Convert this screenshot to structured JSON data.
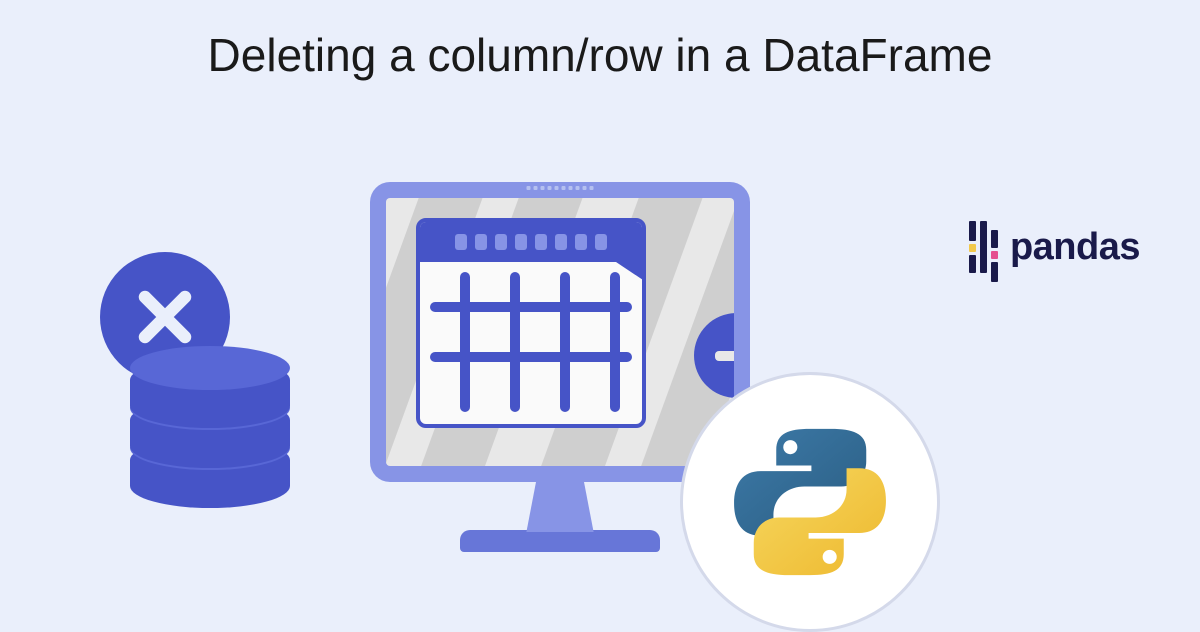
{
  "title": "Deleting a column/row in a DataFrame",
  "pandas_label": "pandas",
  "icons": {
    "x_badge": "close-icon",
    "minus_badge": "minus-icon",
    "database": "database-icon",
    "monitor": "monitor-icon",
    "grid": "grid-icon",
    "python": "python-logo-icon",
    "pandas": "pandas-logo-icon"
  },
  "colors": {
    "background": "#eaeffb",
    "primary_blue": "#4654c7",
    "light_blue": "#8794e6",
    "python_blue": "#3d7aa8",
    "python_yellow": "#f2c94c",
    "pandas_navy": "#1a1a4a",
    "pandas_pink": "#e54f8f",
    "pandas_yellow": "#f2c94c"
  }
}
